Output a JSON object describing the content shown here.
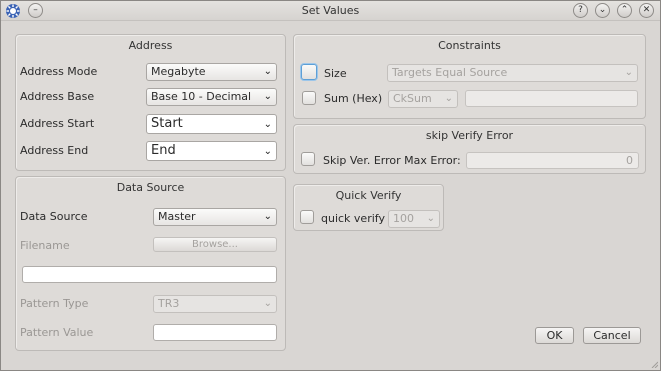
{
  "window": {
    "title": "Set Values",
    "help_icon": "?",
    "minimize_icon": "chevron-down",
    "maximize_icon": "chevron-up",
    "close_icon": "x"
  },
  "address": {
    "title": "Address",
    "mode_label": "Address Mode",
    "mode_value": "Megabyte",
    "base_label": "Address Base",
    "base_value": "Base 10 - Decimal",
    "start_label": "Address Start",
    "start_value": "Start",
    "end_label": "Address End",
    "end_value": "End"
  },
  "data_source": {
    "title": "Data Source",
    "source_label": "Data Source",
    "source_value": "Master",
    "filename_label": "Filename",
    "browse_label": "Browse...",
    "pattern_type_label": "Pattern Type",
    "pattern_type_value": "TR3",
    "pattern_value_label": "Pattern Value"
  },
  "constraints": {
    "title": "Constraints",
    "size_label": "Size",
    "size_value": "Targets Equal Source",
    "sum_label": "Sum (Hex)",
    "sum_value": "CkSum"
  },
  "skip_verify": {
    "title": "skip Verify Error",
    "max_label": "Skip Ver. Error Max Error:",
    "max_value": "0"
  },
  "quick_verify": {
    "title": "Quick Verify",
    "label": "quick verify",
    "value": "100"
  },
  "buttons": {
    "ok": "OK",
    "cancel": "Cancel"
  },
  "colors": {
    "dialog_bg": "#d9d6d3",
    "focus_accent": "#5d9fd6"
  }
}
